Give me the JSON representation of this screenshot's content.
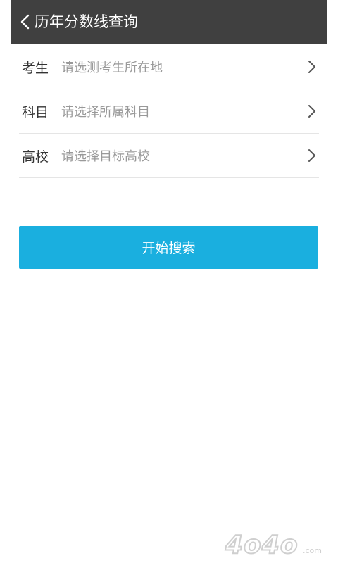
{
  "header": {
    "title": "历年分数线查询",
    "back_icon": "chevron-left-icon"
  },
  "form": {
    "rows": [
      {
        "label": "考生",
        "placeholder": "请选测考生所在地",
        "icon": "chevron-right-icon"
      },
      {
        "label": "科目",
        "placeholder": "请选择所属科目",
        "icon": "chevron-right-icon"
      },
      {
        "label": "高校",
        "placeholder": "请选择目标高校",
        "icon": "chevron-right-icon"
      }
    ]
  },
  "search_button": {
    "label": "开始搜索",
    "color": "#1aafdf"
  },
  "watermark": {
    "text": "4o4o.com"
  },
  "colors": {
    "header_bg": "#404040",
    "accent": "#1aafdf",
    "placeholder": "#999999",
    "label": "#333333",
    "divider": "#e5e5e5"
  }
}
